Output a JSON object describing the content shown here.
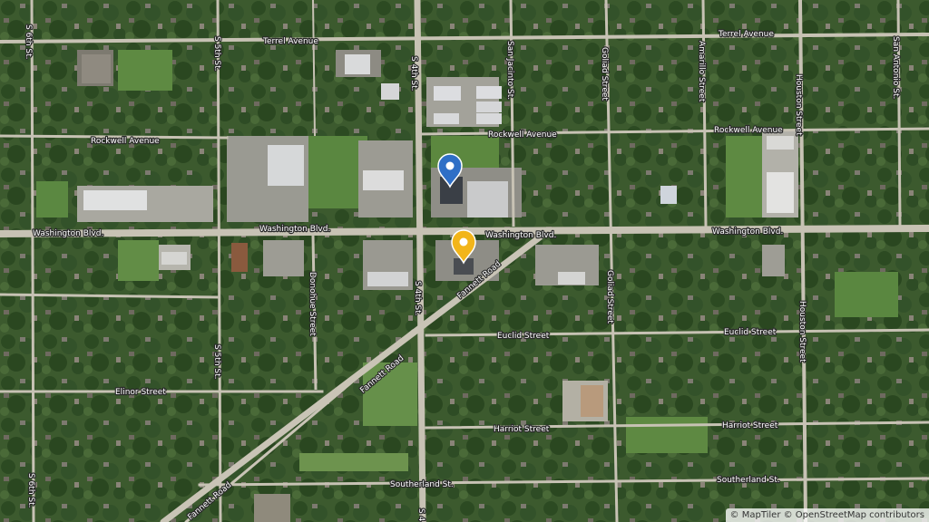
{
  "map": {
    "streets": {
      "terrel_west": "Terrel Avenue",
      "terrel_east": "Terrel Avenue",
      "rockwell_west": "Rockwell Avenue",
      "rockwell_mid": "Rockwell Avenue",
      "rockwell_east": "Rockwell Avenue",
      "washington_west": "Washington Blvd.",
      "washington_mid": "Washington Blvd.",
      "washington_east": "Washington Blvd.",
      "euclid_mid": "Euclid Street",
      "euclid_east": "Euclid Street",
      "elinor": "Elinor Street",
      "harriot_mid": "Harriot Street",
      "harriot_east": "Harriot Street",
      "southerland_mid": "Southerland St.",
      "southerland_east": "Southerland St.",
      "s6th_top": "S 6th St.",
      "s6th_bottom": "S 6th St.",
      "s5th_top": "S 5th St.",
      "s5th_bottom": "S 5th St.",
      "s4th_top": "S 4th St.",
      "s4th_mid": "S 4th St.",
      "s4th_bottom": "S 4",
      "san_jacinto": "San Jacinto St.",
      "goliad_top": "Goliad Street",
      "goliad_mid": "Goliad Street",
      "amarillo": "Amarillo Street",
      "houston_top": "Houston Street",
      "houston_mid": "Houston Street",
      "san_antonio": "San Antonio St.",
      "donohue": "Donohue Street",
      "fannett_upper": "Fannett Road",
      "fannett_mid": "Fannett Road",
      "fannett_lower": "Fannett Road"
    },
    "markers": [
      {
        "name": "blue-location-pin",
        "color": "#2f6fc6"
      },
      {
        "name": "yellow-location-pin",
        "color": "#f2b51a"
      }
    ],
    "attribution": "© MapTiler © OpenStreetMap contributors"
  }
}
